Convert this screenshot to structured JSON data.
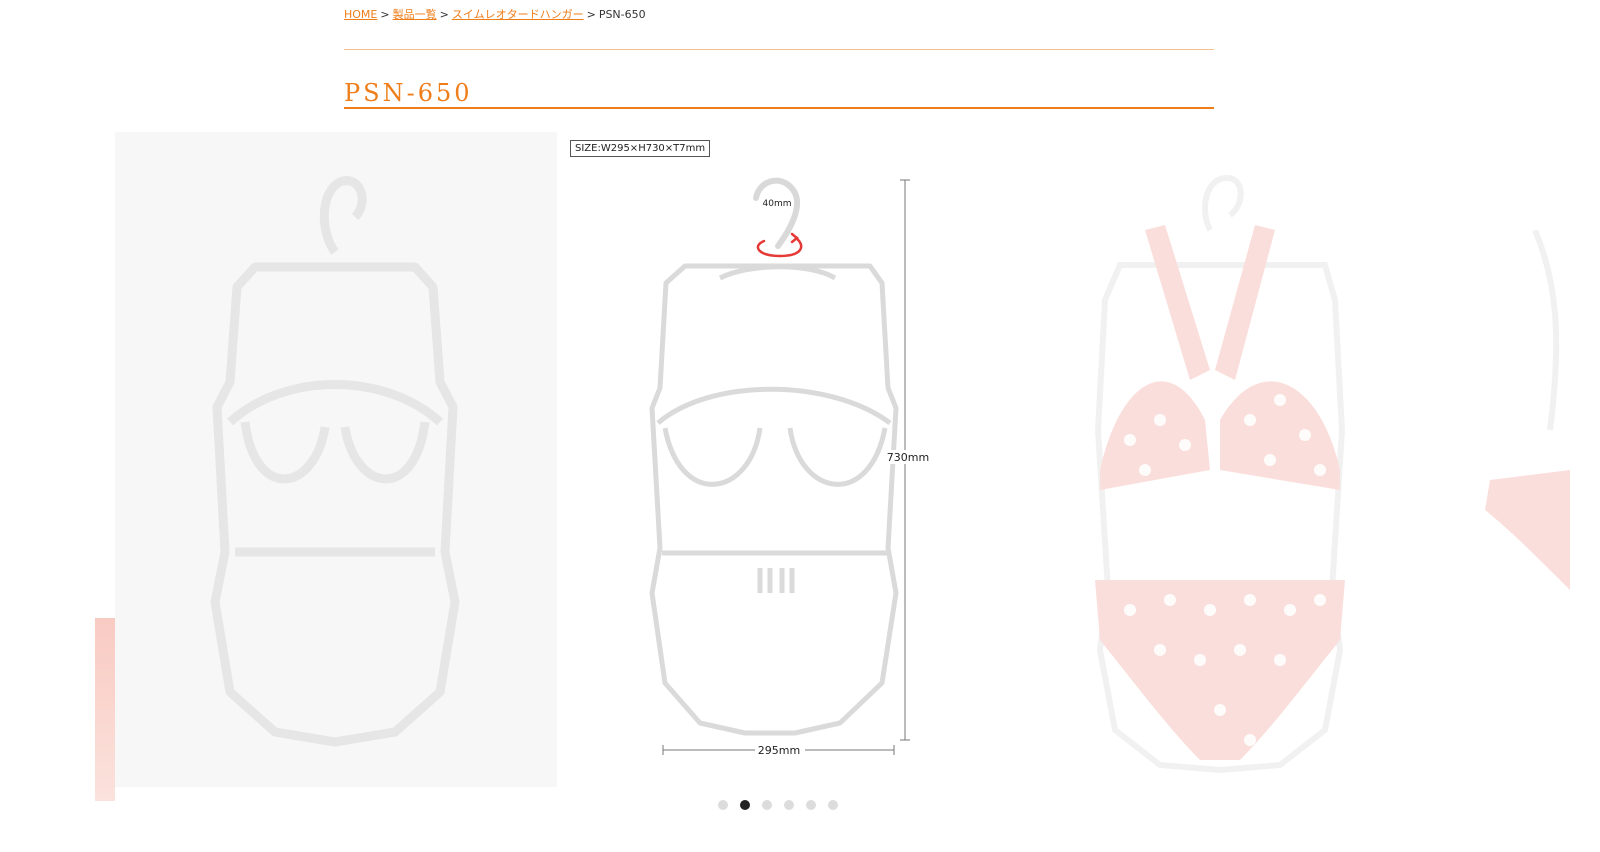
{
  "breadcrumb": {
    "home": "HOME",
    "products": "製品一覧",
    "category": "スイムレオタードハンガー",
    "current": "PSN-650",
    "separator": ">"
  },
  "product": {
    "title": "PSN-650",
    "size_label": "SIZE:W295×H730×T7mm",
    "dim_height": "730mm",
    "dim_width": "295mm",
    "dim_hook": "40mm"
  },
  "carousel": {
    "dot_count": 6,
    "active_index": 1
  },
  "colors": {
    "accent": "#ee7d1a",
    "accent_light": "#f5c392",
    "rotate_arrow": "#e53935",
    "swimsuit": "#f2a39a"
  },
  "icons": {
    "rotate": "rotate-arrow-icon"
  }
}
